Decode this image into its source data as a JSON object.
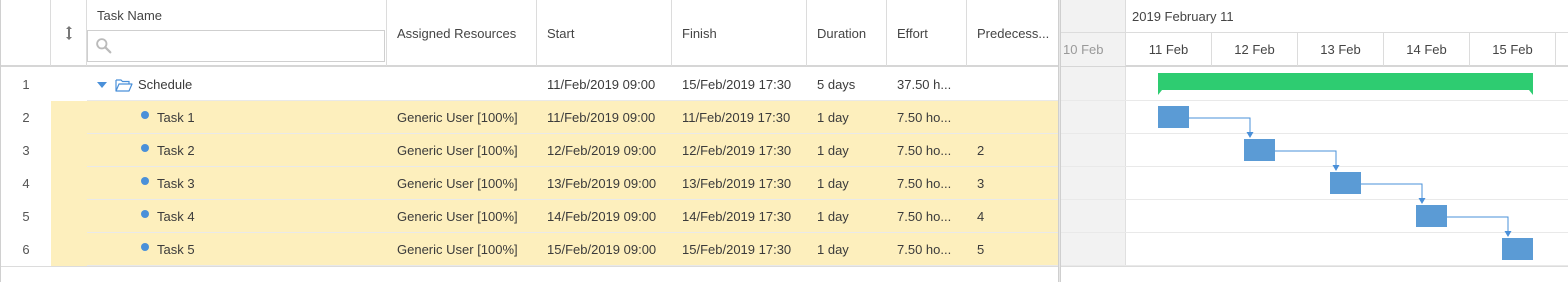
{
  "columns": {
    "task_name": "Task Name",
    "assigned_resources": "Assigned Resources",
    "start": "Start",
    "finish": "Finish",
    "duration": "Duration",
    "effort": "Effort",
    "predecessors": "Predecess..."
  },
  "filter": {
    "placeholder": ""
  },
  "rows": [
    {
      "num": "1",
      "name": "Schedule",
      "resources": "",
      "start": "11/Feb/2019 09:00",
      "finish": "15/Feb/2019 17:30",
      "duration": "5 days",
      "effort": "37.50 h...",
      "pred": ""
    },
    {
      "num": "2",
      "name": "Task 1",
      "resources": "Generic User [100%]",
      "start": "11/Feb/2019 09:00",
      "finish": "11/Feb/2019 17:30",
      "duration": "1 day",
      "effort": "7.50 ho...",
      "pred": ""
    },
    {
      "num": "3",
      "name": "Task 2",
      "resources": "Generic User [100%]",
      "start": "12/Feb/2019 09:00",
      "finish": "12/Feb/2019 17:30",
      "duration": "1 day",
      "effort": "7.50 ho...",
      "pred": "2"
    },
    {
      "num": "4",
      "name": "Task 3",
      "resources": "Generic User [100%]",
      "start": "13/Feb/2019 09:00",
      "finish": "13/Feb/2019 17:30",
      "duration": "1 day",
      "effort": "7.50 ho...",
      "pred": "3"
    },
    {
      "num": "5",
      "name": "Task 4",
      "resources": "Generic User [100%]",
      "start": "14/Feb/2019 09:00",
      "finish": "14/Feb/2019 17:30",
      "duration": "1 day",
      "effort": "7.50 ho...",
      "pred": "4"
    },
    {
      "num": "6",
      "name": "Task 5",
      "resources": "Generic User [100%]",
      "start": "15/Feb/2019 09:00",
      "finish": "15/Feb/2019 17:30",
      "duration": "1 day",
      "effort": "7.50 ho...",
      "pred": "5"
    }
  ],
  "timeline": {
    "week_label": "2019 February 11",
    "days": [
      "10 Feb",
      "11 Feb",
      "12 Feb",
      "13 Feb",
      "14 Feb",
      "15 Feb"
    ]
  },
  "colors": {
    "summary_bar": "#2ecc71",
    "task_bar": "#5b9bd5",
    "link": "#4a90d9",
    "row_highlight": "#fdefbd"
  },
  "icons": {
    "sort": "sort-arrows-icon",
    "search": "search-icon",
    "expand": "caret-down-icon",
    "folder": "folder-open-icon",
    "task": "task-dot-icon"
  }
}
